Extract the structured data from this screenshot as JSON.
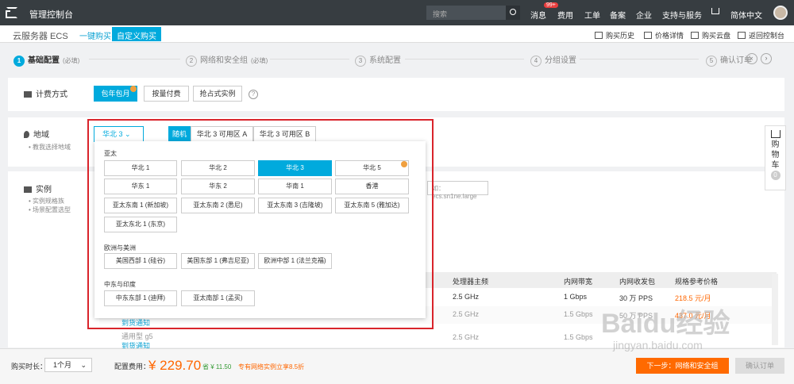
{
  "topbar": {
    "title": "管理控制台",
    "search_placeholder": "搜索",
    "nav": [
      "消息",
      "费用",
      "工单",
      "备案",
      "企业",
      "支持与服务",
      "简体中文"
    ],
    "badge": "99+"
  },
  "subbar": {
    "title": "云服务器 ECS",
    "tab_quick": "一键购买",
    "tab_custom": "自定义购买",
    "tools": [
      "购买历史",
      "价格详情",
      "购买云盘",
      "返回控制台"
    ]
  },
  "steps": [
    {
      "num": "1",
      "label": "基础配置",
      "req": "(必填)"
    },
    {
      "num": "2",
      "label": "网络和安全组",
      "req": "(必填)"
    },
    {
      "num": "3",
      "label": "系统配置",
      "req": ""
    },
    {
      "num": "4",
      "label": "分组设置",
      "req": ""
    },
    {
      "num": "5",
      "label": "确认订单",
      "req": ""
    }
  ],
  "billing": {
    "label": "计费方式",
    "options": [
      "包年包月",
      "按量付费",
      "抢占式实例"
    ],
    "help": "?"
  },
  "region": {
    "label": "地域",
    "sub": "• 教我选择地域",
    "selected": "华北 3",
    "zones": [
      "随机分配",
      "华北 3 可用区 A",
      "华北 3 可用区 B"
    ]
  },
  "instance": {
    "label": "实例",
    "sub1": "• 实例规格族",
    "sub2": "• 场景配置选型",
    "search_value": "如：ecs.sn1ne.large"
  },
  "popup": {
    "groups": [
      {
        "name": "亚太",
        "regions": [
          "华北 1",
          "华北 2",
          "华北 3",
          "华北 5",
          "华东 1",
          "华东 2",
          "华南 1",
          "香港",
          "亚太东南 1 (新加坡)",
          "亚太东南 2 (悉尼)",
          "亚太东南 3 (吉隆坡)",
          "亚太东南 5 (雅加达)",
          "亚太东北 1 (东京)"
        ]
      },
      {
        "name": "欧洲与美洲",
        "regions": [
          "美国西部 1 (硅谷)",
          "美国东部 1 (弗吉尼亚)",
          "欧洲中部 1 (法兰克福)"
        ]
      },
      {
        "name": "中东与印度",
        "regions": [
          "中东东部 1 (迪拜)",
          "亚太南部 1 (孟买)"
        ]
      }
    ]
  },
  "table": {
    "headers": [
      "处理器主频",
      "内网带宽",
      "内网收发包",
      "规格参考价格"
    ],
    "rows": [
      [
        "2.5 GHz",
        "1 Gbps",
        "30 万 PPS",
        "218.5 元/月"
      ],
      [
        "2.5 GHz",
        "1.5 Gbps",
        "50 万 PPS",
        "437.0 元/月"
      ],
      [
        "2.5 GHz",
        "1.5 Gbps",
        "",
        ""
      ]
    ],
    "row_notes": [
      "到货通知",
      "通用型 g5",
      "到货通知"
    ]
  },
  "cart": {
    "label": "购物车",
    "count": "0"
  },
  "bottom": {
    "duration_label": "购买时长：",
    "duration": "1个月",
    "fee_label": "配置费用：",
    "price": "¥ 229.70",
    "save": "省 ¥ 11.50",
    "promo": "专有网络实例立享8.5折",
    "next": "下一步：网络和安全组",
    "confirm": "确认订单"
  },
  "watermark": {
    "main": "Baidu经验",
    "url": "jingyan.baidu.com"
  }
}
